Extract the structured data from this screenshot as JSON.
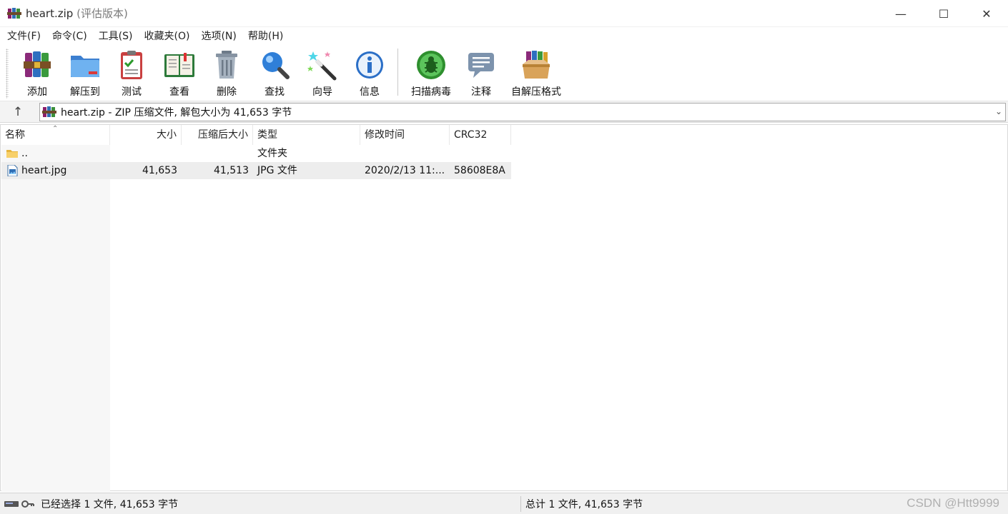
{
  "window": {
    "title": "heart.zip",
    "title_suffix": "(评估版本)",
    "minimize_glyph": "—",
    "maximize_glyph": "☐",
    "close_glyph": "✕"
  },
  "menu": [
    "文件(F)",
    "命令(C)",
    "工具(S)",
    "收藏夹(O)",
    "选项(N)",
    "帮助(H)"
  ],
  "toolbar": {
    "add": "添加",
    "extract_to": "解压到",
    "test": "测试",
    "view": "查看",
    "delete": "删除",
    "find": "查找",
    "wizard": "向导",
    "info": "信息",
    "virus_scan": "扫描病毒",
    "comment": "注释",
    "sfx": "自解压格式"
  },
  "address": {
    "text": "heart.zip - ZIP 压缩文件, 解包大小为 41,653 字节"
  },
  "columns": {
    "name": "名称",
    "size": "大小",
    "packed": "压缩后大小",
    "type": "类型",
    "modified": "修改时间",
    "crc": "CRC32"
  },
  "rows": [
    {
      "name": "..",
      "size": "",
      "packed": "",
      "type": "文件夹",
      "modified": "",
      "crc": ""
    },
    {
      "name": "heart.jpg",
      "size": "41,653",
      "packed": "41,513",
      "type": "JPG 文件",
      "modified": "2020/2/13 11:...",
      "crc": "58608E8A"
    }
  ],
  "status": {
    "left": "已经选择 1 文件, 41,653 字节",
    "right": "总计 1 文件, 41,653 字节",
    "watermark": "CSDN @Htt9999"
  },
  "icons": {
    "app": "winrar-books-icon",
    "folder": "folder-icon",
    "file": "image-file-icon"
  }
}
